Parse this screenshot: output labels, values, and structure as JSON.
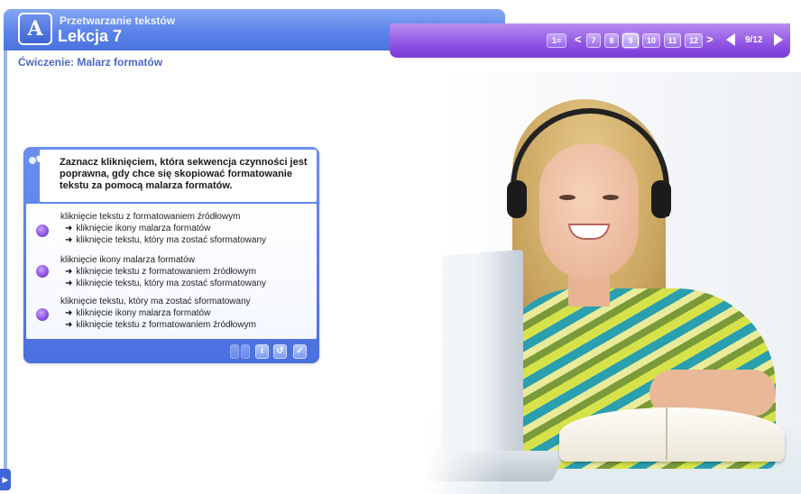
{
  "header": {
    "course_title": "Przetwarzanie tekstów",
    "lesson_title": "Lekcja 7",
    "logo_text": "A"
  },
  "navigation": {
    "toc_label": "1≡",
    "prev_range": "<",
    "next_range": ">",
    "pages": [
      "7",
      "8",
      "9",
      "10",
      "11",
      "12"
    ],
    "active_page": "9",
    "counter": "9/12"
  },
  "exercise": {
    "title": "Ćwiczenie: Malarz formatów",
    "question": "Zaznacz kliknięciem, która sekwencja czynności jest poprawna, gdy chce się skopiować formatowanie tekstu za pomocą malarza formatów.",
    "options": [
      {
        "line1": "kliknięcie tekstu z formatowaniem źródłowym",
        "line2": "kliknięcie ikony malarza formatów",
        "line3": "kliknięcie tekstu, który ma zostać sformatowany"
      },
      {
        "line1": "kliknięcie ikony malarza formatów",
        "line2": "kliknięcie tekstu z formatowaniem źródłowym",
        "line3": "kliknięcie tekstu, który ma zostać sformatowany"
      },
      {
        "line1": "kliknięcie tekstu, który ma zostać sformatowany",
        "line2": "kliknięcie ikony malarza formatów",
        "line3": "kliknięcie tekstu z formatowaniem źródłowym"
      }
    ]
  },
  "toolbar": {
    "info_glyph": "i",
    "retry_glyph": "↺",
    "check_glyph": "✓"
  },
  "colors": {
    "header_blue": "#5b83ea",
    "nav_purple": "#8f54e4",
    "exercise_title": "#4b67c8",
    "radio": "#8a4fe0"
  },
  "icons": [
    "logo-icon",
    "question-bulb-icon",
    "arrow-right-icon",
    "prev-icon",
    "next-icon",
    "info-icon",
    "retry-icon",
    "check-icon"
  ]
}
